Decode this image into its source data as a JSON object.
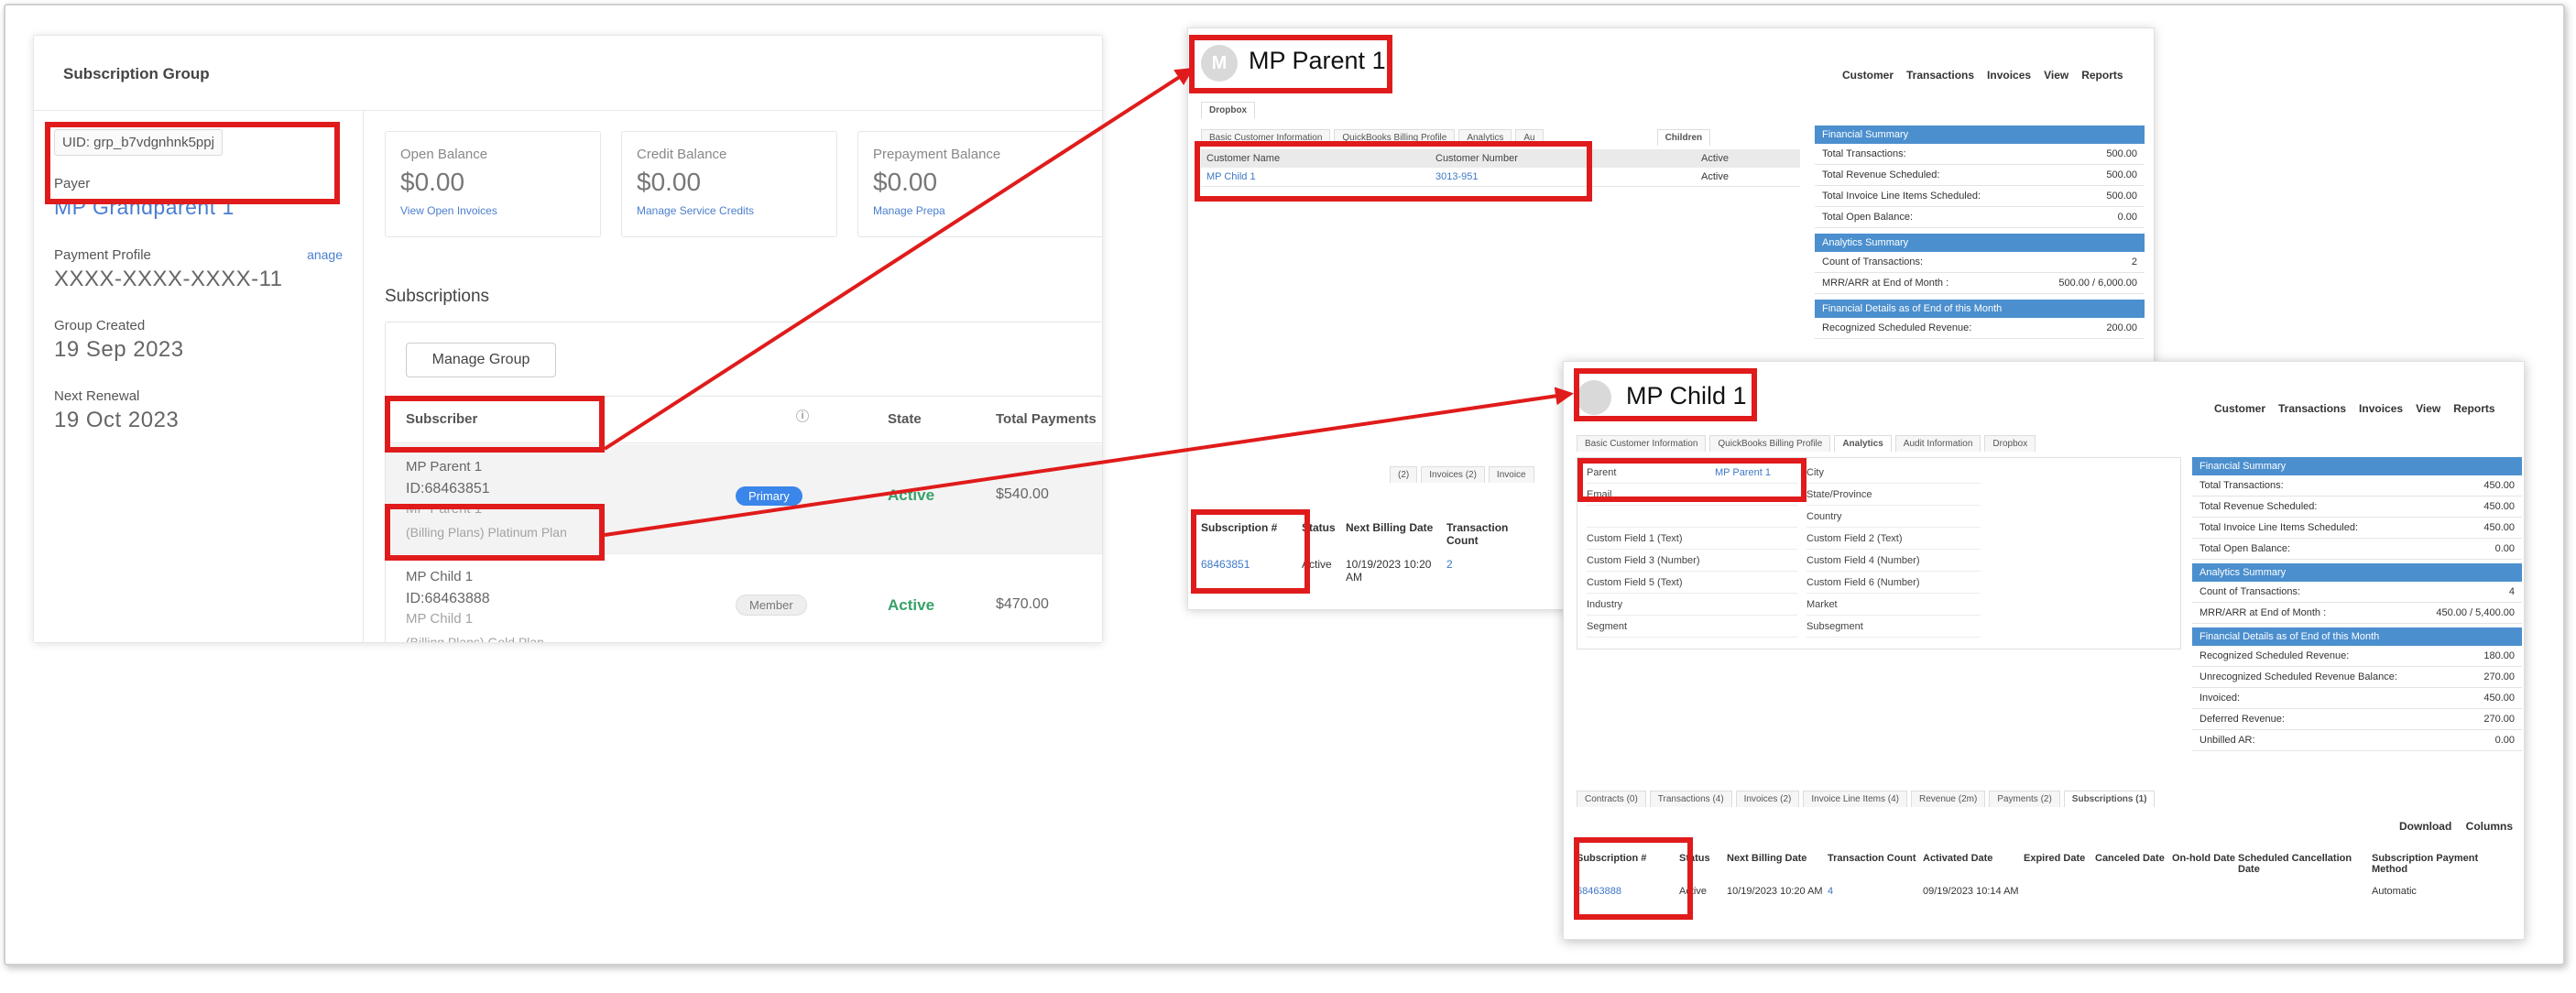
{
  "subscription_group": {
    "title": "Subscription Group",
    "uid": "UID: grp_b7vdgnhnk5ppj",
    "payer_label": "Payer",
    "payer_name": "MP Grandparent 1",
    "payment_profile_label": "Payment Profile",
    "payment_profile_manage": "anage",
    "payment_profile_value": "XXXX-XXXX-XXXX-11",
    "group_created_label": "Group Created",
    "group_created_value": "19 Sep 2023",
    "next_renewal_label": "Next Renewal",
    "next_renewal_value": "19 Oct 2023",
    "cards": [
      {
        "title": "Open Balance",
        "value": "$0.00",
        "link": "View Open Invoices"
      },
      {
        "title": "Credit Balance",
        "value": "$0.00",
        "link": "Manage Service Credits"
      },
      {
        "title": "Prepayment Balance",
        "value": "$0.00",
        "link": "Manage Prepa"
      }
    ],
    "subscriptions_label": "Subscriptions",
    "manage_group_button": "Manage Group",
    "columns": {
      "subscriber": "Subscriber",
      "state": "State",
      "total_payments": "Total Payments"
    },
    "rows": [
      {
        "name": "MP Parent 1",
        "id": "ID:68463851",
        "under": "MP Parent 1",
        "plan": "(Billing Plans) Platinum Plan",
        "role": "Primary",
        "state": "Active",
        "total": "$540.00"
      },
      {
        "name": "MP Child 1",
        "id": "ID:68463888",
        "under": "MP Child 1",
        "plan": "(Billing Plans) Gold Plan",
        "role": "Member",
        "state": "Active",
        "total": "$470.00"
      }
    ]
  },
  "parent_window": {
    "avatar_letter": "M",
    "title": "MP Parent 1",
    "nav": [
      "Customer",
      "Transactions",
      "Invoices",
      "View",
      "Reports"
    ],
    "dropbox_tab": "Dropbox",
    "tabs": [
      "Basic Customer Information",
      "QuickBooks Billing Profile",
      "Analytics",
      "Au",
      "Children"
    ],
    "children_table": {
      "headers": [
        "Customer Name",
        "Customer Number",
        "Active"
      ],
      "row": [
        "MP Child 1",
        "3013-951",
        "Active"
      ]
    },
    "financial_summary": {
      "header": "Financial Summary",
      "rows": [
        [
          "Total Transactions:",
          "500.00"
        ],
        [
          "Total Revenue Scheduled:",
          "500.00"
        ],
        [
          "Total Invoice Line Items Scheduled:",
          "500.00"
        ],
        [
          "Total Open Balance:",
          "0.00"
        ]
      ]
    },
    "analytics_summary": {
      "header": "Analytics Summary",
      "rows": [
        [
          "Count of Transactions:",
          "2"
        ],
        [
          "MRR/ARR at End of Month :",
          "500.00 / 6,000.00"
        ]
      ]
    },
    "financial_details": {
      "header": "Financial Details as of End of this Month",
      "rows": [
        [
          "Recognized Scheduled Revenue:",
          "200.00"
        ]
      ]
    },
    "bottom_tabs": [
      "(2)",
      "Invoices (2)",
      "Invoice"
    ],
    "sub_table": {
      "headers": [
        "Subscription #",
        "Status",
        "Next Billing Date",
        "Transaction Count"
      ],
      "row": [
        "68463851",
        "Active",
        "10/19/2023 10:20 AM",
        "2"
      ]
    }
  },
  "child_window": {
    "title": "MP Child 1",
    "nav": [
      "Customer",
      "Transactions",
      "Invoices",
      "View",
      "Reports"
    ],
    "tabs": [
      "Basic Customer Information",
      "QuickBooks Billing Profile",
      "Analytics",
      "Audit Information",
      "Dropbox"
    ],
    "fields_left": [
      "Parent",
      "Email",
      "Custom Field 1 (Text)",
      "Custom Field 3 (Number)",
      "Custom Field 5 (Text)",
      "Industry",
      "Segment"
    ],
    "parent_value": "MP Parent 1",
    "fields_right": [
      "City",
      "State/Province",
      "Country",
      "Custom Field 2 (Text)",
      "Custom Field 4 (Number)",
      "Custom Field 6 (Number)",
      "Market",
      "Subsegment"
    ],
    "financial_summary": {
      "header": "Financial Summary",
      "rows": [
        [
          "Total Transactions:",
          "450.00"
        ],
        [
          "Total Revenue Scheduled:",
          "450.00"
        ],
        [
          "Total Invoice Line Items Scheduled:",
          "450.00"
        ],
        [
          "Total Open Balance:",
          "0.00"
        ]
      ]
    },
    "analytics_summary": {
      "header": "Analytics Summary",
      "rows": [
        [
          "Count of Transactions:",
          "4"
        ],
        [
          "MRR/ARR at End of Month :",
          "450.00 / 5,400.00"
        ]
      ]
    },
    "financial_details": {
      "header": "Financial Details as of End of this Month",
      "rows": [
        [
          "Recognized Scheduled Revenue:",
          "180.00"
        ],
        [
          "Unrecognized Scheduled Revenue Balance:",
          "270.00"
        ],
        [
          "Invoiced:",
          "450.00"
        ],
        [
          "Deferred Revenue:",
          "270.00"
        ],
        [
          "Unbilled AR:",
          "0.00"
        ]
      ]
    },
    "bottom_tabs": [
      "Contracts (0)",
      "Transactions (4)",
      "Invoices (2)",
      "Invoice Line Items (4)",
      "Revenue (2m)",
      "Payments (2)",
      "Subscriptions (1)"
    ],
    "download_label": "Download",
    "columns_label": "Columns",
    "sub_table": {
      "headers": [
        "Subscription #",
        "Status",
        "Next Billing Date",
        "Transaction Count",
        "Activated Date",
        "Expired Date",
        "Canceled Date",
        "On-hold Date",
        "Scheduled Cancellation Date",
        "Subscription Payment Method"
      ],
      "row": [
        "68463888",
        "Active",
        "10/19/2023 10:20 AM",
        "4",
        "09/19/2023 10:14 AM",
        "",
        "",
        "",
        "",
        "Automatic"
      ]
    }
  },
  "annotation_color": "#e01b1b"
}
